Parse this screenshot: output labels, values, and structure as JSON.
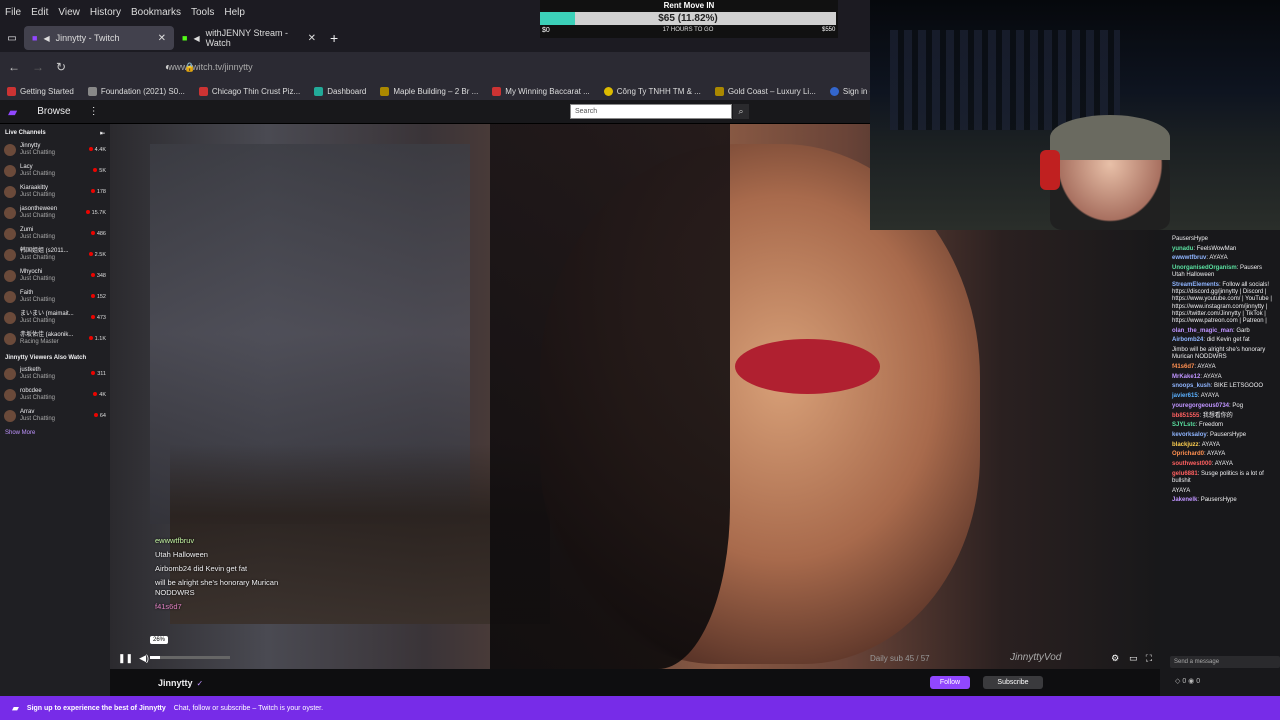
{
  "menu": [
    "File",
    "Edit",
    "View",
    "History",
    "Bookmarks",
    "Tools",
    "Help"
  ],
  "tabs": [
    {
      "label": "Jinnytty - Twitch"
    },
    {
      "label": "withJENNY Stream - Watch"
    }
  ],
  "url": "www.twitch.tv/jinnytty",
  "bookmarks": [
    "Getting Started",
    "Foundation (2021) S0...",
    "Chicago Thin Crust Piz...",
    "Dashboard",
    "Maple Building – 2 Br ...",
    "My Winning Baccarat ...",
    "Công Ty TNHH TM & ...",
    "Gold Coast – Luxury Li...",
    "Sign in - Drea"
  ],
  "twitch": {
    "browse": "Browse",
    "search_placeholder": "Search"
  },
  "sidebar": {
    "live_header": "Live Channels",
    "live": [
      {
        "name": "Jinnytty",
        "cat": "Just Chatting",
        "viewers": "4.4K"
      },
      {
        "name": "Lacy",
        "cat": "Just Chatting",
        "viewers": "5K"
      },
      {
        "name": "Kiaraakitty",
        "cat": "Just Chatting",
        "viewers": "178"
      },
      {
        "name": "jasontheween",
        "cat": "Just Chatting",
        "viewers": "15.7K"
      },
      {
        "name": "Zumi",
        "cat": "Just Chatting",
        "viewers": "486"
      },
      {
        "name": "韩国姐姐 (s2011...",
        "cat": "Just Chatting",
        "viewers": "2.5K"
      },
      {
        "name": "Mhyochi",
        "cat": "Just Chatting",
        "viewers": "348"
      },
      {
        "name": "Faith",
        "cat": "Just Chatting",
        "viewers": "152"
      },
      {
        "name": "まいまい (maimait...",
        "cat": "Just Chatting",
        "viewers": "473"
      },
      {
        "name": "赤坂佑佳 (akaonik...",
        "cat": "Racing Master",
        "viewers": "1.1K"
      }
    ],
    "also_header": "Jinnytty Viewers Also Watch",
    "also": [
      {
        "name": "justketh",
        "cat": "Just Chatting",
        "viewers": "311"
      },
      {
        "name": "robcdee",
        "cat": "Just Chatting",
        "viewers": "4K"
      },
      {
        "name": "Arrav",
        "cat": "Just Chatting",
        "viewers": "64"
      }
    ],
    "show_more": "Show More"
  },
  "overlay_chat": [
    {
      "text": "ewwwtfbruv"
    },
    {
      "text": "Utah Halloween"
    },
    {
      "text": "Airbomb24  did Kevin get fat"
    },
    {
      "text": "will be alright she's honorary Murican NODDWRS"
    },
    {
      "text": "f41s6d7"
    }
  ],
  "player": {
    "volume_pct": "26%",
    "sub_text": "Daily sub 45 / 57",
    "watermark": "JinnyttyVod"
  },
  "channel": {
    "name": "Jinnytty",
    "follow": "Follow",
    "subscribe": "Subscribe"
  },
  "rent": {
    "title": "Rent Move IN",
    "label": "$65 (11.82%)",
    "start": "$0",
    "middle": "17 HOURS TO GO",
    "end": "$550",
    "progress": 0.1182
  },
  "chat_messages": [
    {
      "user": "",
      "text": "PausersHype"
    },
    {
      "user": "yunadu",
      "text": "FeelsWowMan"
    },
    {
      "user": "ewwwtfbruv",
      "text": "AYAYA"
    },
    {
      "user": "UnorganisedOrganism",
      "text": "Pausers Utah Halloween"
    },
    {
      "user": "StreamElements",
      "text": "Follow all socials! https://discord.gg/jinnytty | Discord | https://www.youtube.com/ | YouTube | https://www.instagram.com/jinnytty | https://twitter.com/Jinnytty | TikTok | https://www.patreon.com | Patreon |"
    },
    {
      "user": "olan_the_magic_man",
      "text": "Garb"
    },
    {
      "user": "Airbomb24",
      "text": "did Kevin get fat"
    },
    {
      "user": "",
      "text": "Jimbo will be alright she's honorary Murican NODDWRS"
    },
    {
      "user": "f41s6d7",
      "text": "AYAYA"
    },
    {
      "user": "MrKake12",
      "text": "AYAYA"
    },
    {
      "user": "snoops_kush",
      "text": "BIKE LETSGOOO"
    },
    {
      "user": "javier615",
      "text": "AYAYA"
    },
    {
      "user": "youregorgeous0734",
      "text": "Pog"
    },
    {
      "user": "bb851555",
      "text": "我想看你的"
    },
    {
      "user": "SJYLstc",
      "text": "Freedom"
    },
    {
      "user": "kevorksaloy",
      "text": "PausersHype"
    },
    {
      "user": "blackjuzz",
      "text": "AYAYA"
    },
    {
      "user": "Oprichard0",
      "text": "AYAYA"
    },
    {
      "user": "southwest000",
      "text": "AYAYA"
    },
    {
      "user": "gelu6881",
      "text": "Susge politics is a lot of bullshit"
    },
    {
      "user": "",
      "text": "AYAYA"
    },
    {
      "user": "Jakenelk",
      "text": "PausersHype"
    }
  ],
  "chat_input_placeholder": "Send a message",
  "bottom_banner": {
    "title": "Sign up to experience the best of Jinnytty",
    "sub": "Chat, follow or subscribe – Twitch is your oyster."
  }
}
